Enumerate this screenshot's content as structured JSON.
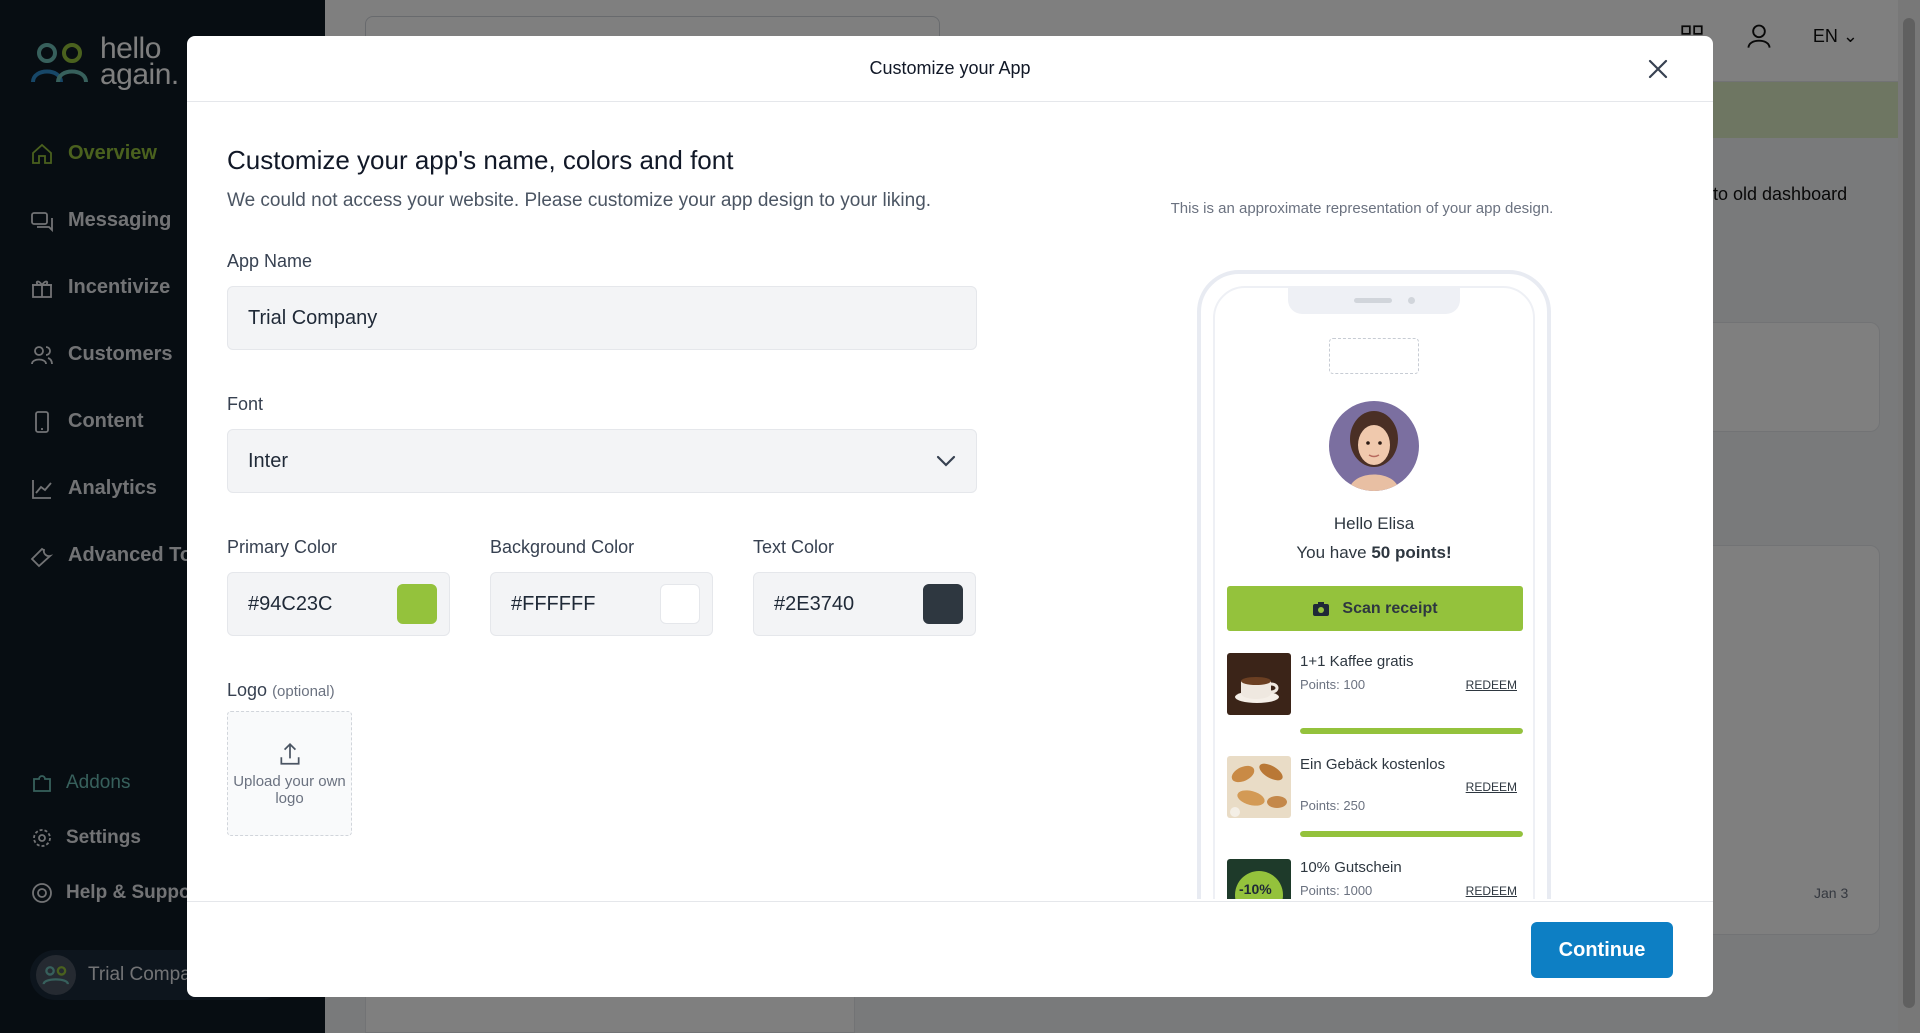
{
  "background": {
    "logo_line1": "hello",
    "logo_line2": "again.",
    "nav": [
      {
        "label": "Overview",
        "icon": "home-icon",
        "active": true
      },
      {
        "label": "Messaging",
        "icon": "messaging-icon"
      },
      {
        "label": "Incentivize",
        "icon": "gift-icon"
      },
      {
        "label": "Customers",
        "icon": "users-icon"
      },
      {
        "label": "Content",
        "icon": "phone-icon"
      },
      {
        "label": "Analytics",
        "icon": "chart-icon"
      },
      {
        "label": "Advanced Too",
        "icon": "wrench-icon"
      }
    ],
    "nav_bottom": [
      {
        "label": "Addons",
        "icon": "puzzle-icon"
      },
      {
        "label": "Settings",
        "icon": "gear-icon"
      },
      {
        "label": "Help & Support",
        "icon": "lifebuoy-icon"
      }
    ],
    "account_name": "Trial Compa",
    "language": "EN",
    "back_link": "ck to old dashboard",
    "chart_tick": "Jan 3"
  },
  "modal": {
    "title": "Customize your App",
    "heading": "Customize your app's name, colors and font",
    "subheading": "We could not access your website. Please customize your app design to your liking.",
    "app_name_label": "App Name",
    "app_name_value": "Trial Company",
    "font_label": "Font",
    "font_value": "Inter",
    "colors": [
      {
        "label": "Primary Color",
        "value": "#94C23C",
        "swatch": "#94C23C"
      },
      {
        "label": "Background Color",
        "value": "#FFFFFF",
        "swatch": "#FFFFFF"
      },
      {
        "label": "Text Color",
        "value": "#2E3740",
        "swatch": "#2E3740"
      }
    ],
    "logo_label": "Logo",
    "logo_optional": "(optional)",
    "upload_text": "Upload your own logo",
    "continue_label": "Continue"
  },
  "preview": {
    "note": "This is an approximate representation of your app design.",
    "greeting": "Hello Elisa",
    "points_prefix": "You have ",
    "points_value": "50 points!",
    "scan_label": "Scan receipt",
    "rewards": [
      {
        "title": "1+1 Kaffee gratis",
        "points": "Points: 100",
        "action": "REDEEM",
        "progress": 1.0
      },
      {
        "title": "Ein Gebäck kostenlos",
        "points": "Points: 250",
        "action": "REDEEM",
        "progress": 1.0
      },
      {
        "title": "10% Gutschein",
        "points": "Points: 1000",
        "action": "REDEEM",
        "badge": "-10%"
      }
    ]
  },
  "colors": {
    "brand_green": "#94C23C",
    "continue_blue": "#0D7FC4",
    "sidebar_bg": "#0F1A24"
  }
}
